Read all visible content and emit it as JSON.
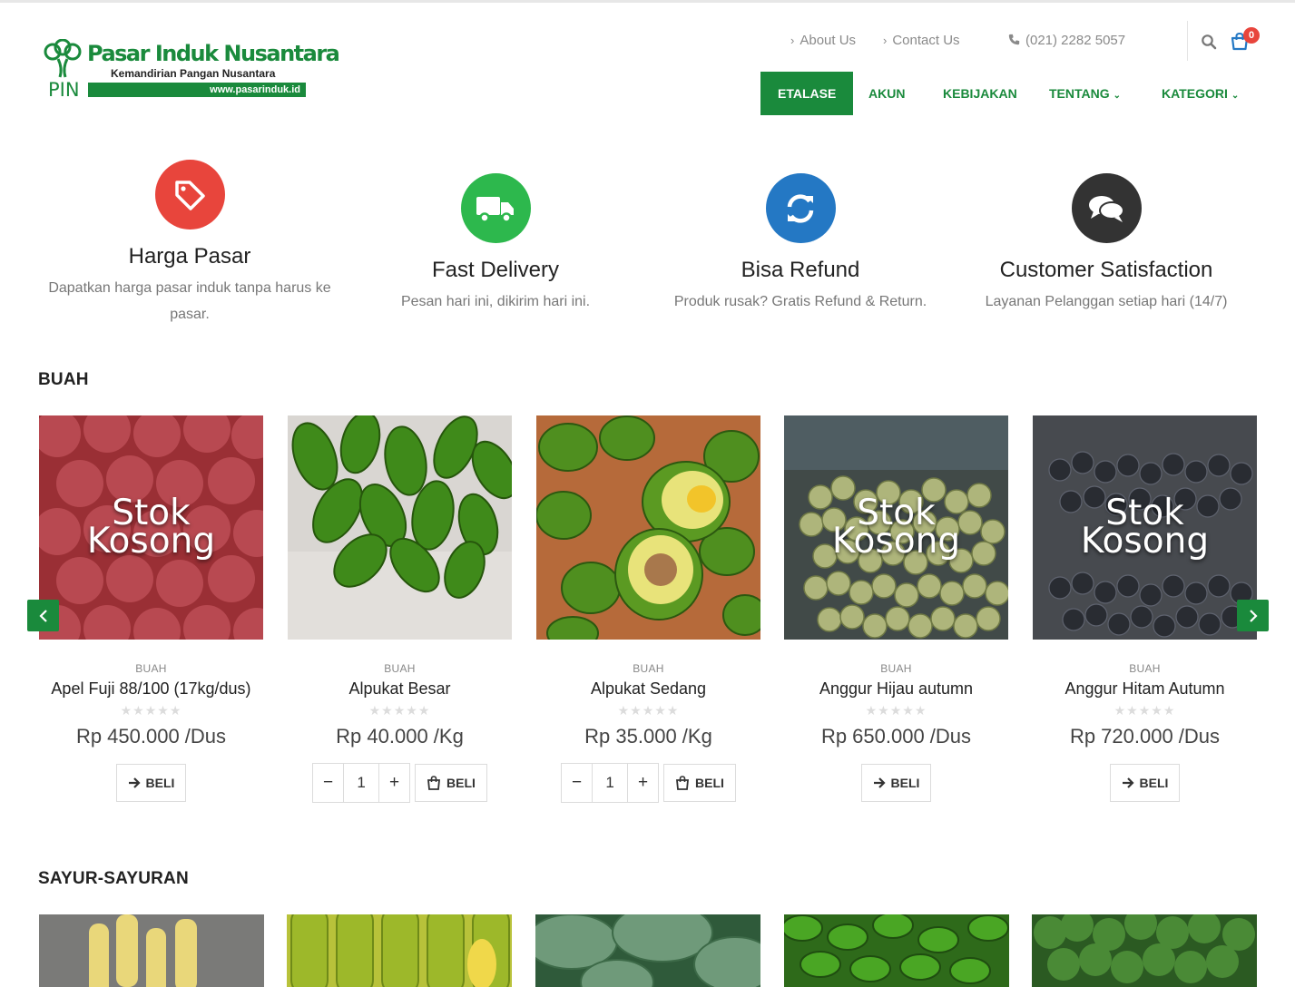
{
  "header": {
    "logo_title": "Pasar Induk Nusantara",
    "logo_subtitle": "Kemandirian Pangan Nusantara",
    "logo_url": "www.pasarinduk.id",
    "logo_pin": "PIN",
    "top_links": {
      "about": "About Us",
      "contact": "Contact Us",
      "phone": "(021) 2282 5057"
    },
    "cart_count": "0",
    "nav": [
      {
        "label": "ETALASE",
        "active": true
      },
      {
        "label": "AKUN"
      },
      {
        "label": "KEBIJAKAN"
      },
      {
        "label": "TENTANG",
        "has_caret": true
      },
      {
        "label": "KATEGORI",
        "has_caret": true
      }
    ],
    "brand_color": "#1a8a3c"
  },
  "features": [
    {
      "icon": "tag-icon",
      "color": "#e8453c",
      "title": "Harga Pasar",
      "text": "Dapatkan harga pasar induk tanpa harus ke pasar."
    },
    {
      "icon": "truck-icon",
      "color": "#2db84d",
      "title": "Fast Delivery",
      "text": "Pesan hari ini, dikirim hari ini."
    },
    {
      "icon": "refresh-icon",
      "color": "#2478c4",
      "title": "Bisa Refund",
      "text": "Produk rusak? Gratis Refund & Return."
    },
    {
      "icon": "chat-icon",
      "color": "#333333",
      "title": "Customer Satisfaction",
      "text": "Layanan Pelanggan setiap hari (14/7)"
    }
  ],
  "sections": {
    "buah": {
      "title": "BUAH",
      "products": [
        {
          "category": "BUAH",
          "name": "Apel Fuji 88/100 (17kg/dus)",
          "price": "Rp 450.000 /Dus",
          "out_of_stock": true,
          "stock_label_1": "Stok",
          "stock_label_2": "Kosong",
          "buy_label": "BELI"
        },
        {
          "category": "BUAH",
          "name": "Alpukat Besar",
          "price": "Rp 40.000 /Kg",
          "out_of_stock": false,
          "qty": "1",
          "buy_label": "BELI"
        },
        {
          "category": "BUAH",
          "name": "Alpukat Sedang",
          "price": "Rp 35.000 /Kg",
          "out_of_stock": false,
          "qty": "1",
          "buy_label": "BELI"
        },
        {
          "category": "BUAH",
          "name": "Anggur Hijau autumn",
          "price": "Rp 650.000 /Dus",
          "out_of_stock": true,
          "stock_label_1": "Stok",
          "stock_label_2": "Kosong",
          "buy_label": "BELI"
        },
        {
          "category": "BUAH",
          "name": "Anggur Hitam Autumn",
          "price": "Rp 720.000 /Dus",
          "out_of_stock": true,
          "stock_label_1": "Stok",
          "stock_label_2": "Kosong",
          "buy_label": "BELI"
        }
      ]
    },
    "sayur": {
      "title": "SAYUR-SAYURAN"
    }
  },
  "rating_stars": "★★★★★",
  "qty_controls": {
    "minus": "−",
    "plus": "+"
  }
}
